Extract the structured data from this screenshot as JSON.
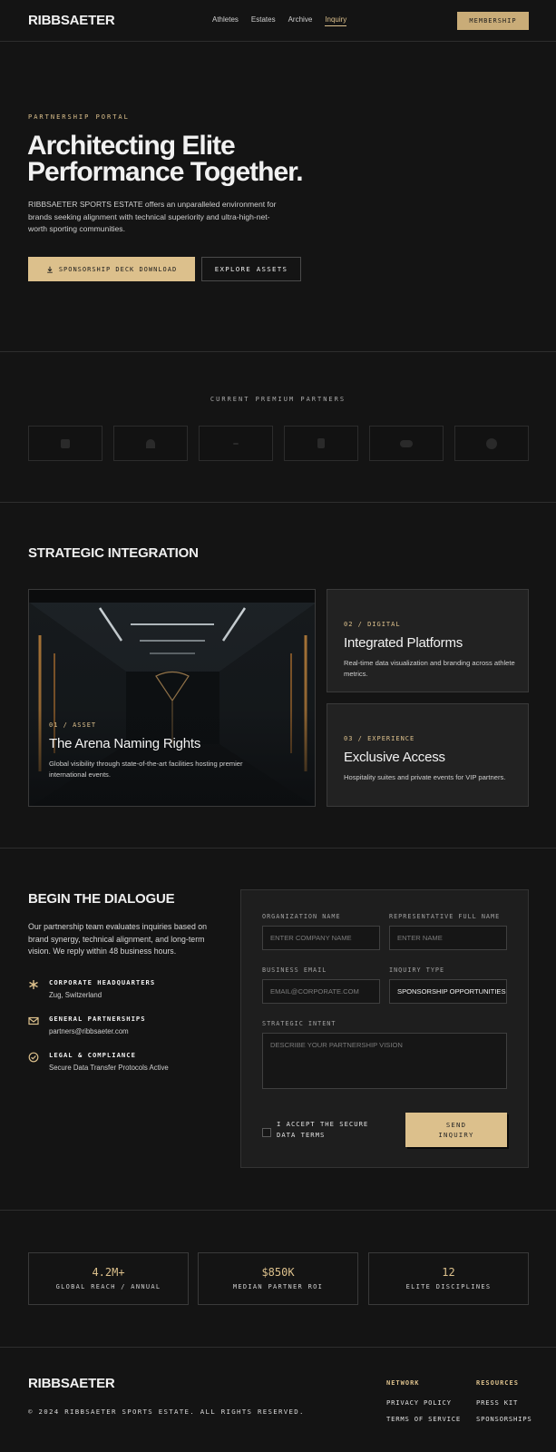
{
  "nav": {
    "logo": "RIBBSAETER",
    "links": [
      "Athletes",
      "Estates",
      "Archive",
      "Inquiry"
    ],
    "membership_label": "MEMBERSHIP"
  },
  "hero": {
    "eyebrow": "PARTNERSHIP PORTAL",
    "title_line1": "Architecting Elite",
    "title_line2": "Performance Together.",
    "description": "RIBBSAETER SPORTS ESTATE offers an unparalleled environment for brands seeking alignment with technical superiority and ultra-high-net-worth sporting communities.",
    "primary_button": "SPONSORSHIP DECK DOWNLOAD",
    "secondary_button": "EXPLORE ASSETS"
  },
  "partners": {
    "title": "CURRENT PREMIUM PARTNERS"
  },
  "strategic": {
    "title": "STRATEGIC INTEGRATION",
    "cards": [
      {
        "tag": "01 / ASSET",
        "title": "The Arena Naming Rights",
        "description": "Global visibility through state-of-the-art facilities hosting premier international events."
      },
      {
        "tag": "02 / DIGITAL",
        "title": "Integrated Platforms",
        "description": "Real-time data visualization and branding across athlete metrics."
      },
      {
        "tag": "03 / EXPERIENCE",
        "title": "Exclusive Access",
        "description": "Hospitality suites and private events for VIP partners."
      }
    ]
  },
  "dialogue": {
    "title": "BEGIN THE DIALOGUE",
    "description": "Our partnership team evaluates inquiries based on brand synergy, technical alignment, and long-term vision. We reply within 48 business hours.",
    "contacts": [
      {
        "icon": "asterisk-icon",
        "title": "CORPORATE HEADQUARTERS",
        "value": "Zug, Switzerland"
      },
      {
        "icon": "envelope-icon",
        "title": "GENERAL PARTNERSHIPS",
        "value": "partners@ribbsaeter.com"
      },
      {
        "icon": "check-circle-icon",
        "title": "LEGAL & COMPLIANCE",
        "value": "Secure Data Transfer Protocols Active"
      }
    ],
    "form": {
      "org_label": "ORGANIZATION NAME",
      "org_placeholder": "ENTER COMPANY NAME",
      "rep_label": "REPRESENTATIVE FULL NAME",
      "rep_placeholder": "ENTER NAME",
      "email_label": "BUSINESS EMAIL",
      "email_placeholder": "EMAIL@CORPORATE.COM",
      "type_label": "INQUIRY TYPE",
      "type_value": "SPONSORSHIP OPPORTUNITIES",
      "intent_label": "STRATEGIC INTENT",
      "intent_placeholder": "DESCRIBE YOUR PARTNERSHIP VISION",
      "checkbox_label": "I ACCEPT THE SECURE DATA TERMS",
      "send_label": "SEND INQUIRY"
    }
  },
  "stats": [
    {
      "value": "4.2M+",
      "label": "GLOBAL REACH / ANNUAL"
    },
    {
      "value": "$850K",
      "label": "MEDIAN PARTNER ROI"
    },
    {
      "value": "12",
      "label": "ELITE DISCIPLINES"
    }
  ],
  "footer": {
    "logo": "RIBBSAETER",
    "copyright": "© 2024 RIBBSAETER SPORTS ESTATE. ALL RIGHTS RESERVED.",
    "network_heading": "NETWORK",
    "network_links": [
      "PRIVACY POLICY",
      "TERMS OF SERVICE"
    ],
    "resources_heading": "RESOURCES",
    "resources_links": [
      "PRESS KIT",
      "SPONSORSHIPS"
    ]
  },
  "colors": {
    "accent": "#dcc08c",
    "background": "#141414",
    "card": "#222222"
  }
}
